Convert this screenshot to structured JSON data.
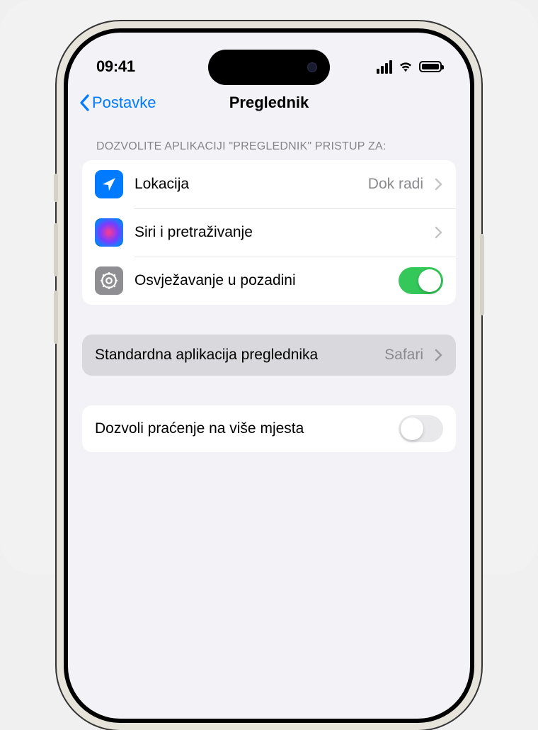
{
  "statusBar": {
    "time": "09:41"
  },
  "nav": {
    "back": "Postavke",
    "title": "Preglednik"
  },
  "sectionHeader": "DOZVOLITE APLIKACIJI \"PREGLEDNIK\" PRISTUP ZA:",
  "rows": {
    "location": {
      "label": "Lokacija",
      "value": "Dok radi"
    },
    "siri": {
      "label": "Siri i pretraživanje"
    },
    "backgroundRefresh": {
      "label": "Osvježavanje u pozadini",
      "enabled": true
    },
    "defaultBrowser": {
      "label": "Standardna aplikacija preglednika",
      "value": "Safari"
    },
    "tracking": {
      "label": "Dozvoli praćenje na više mjesta",
      "enabled": false
    }
  },
  "icons": {
    "location": "location-arrow",
    "siri": "siri-orb",
    "gear": "gear"
  }
}
